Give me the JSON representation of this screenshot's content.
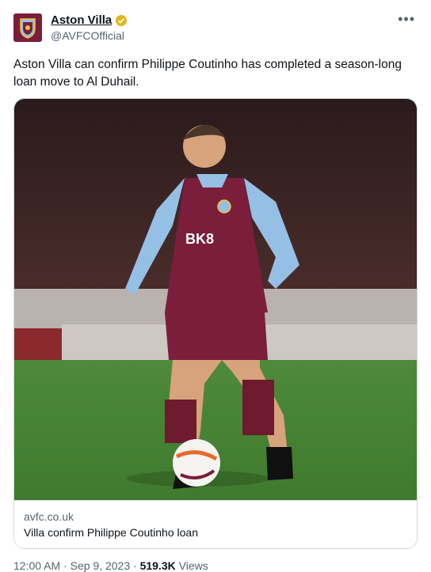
{
  "account": {
    "name": "Aston Villa",
    "handle": "@AVFCOfficial",
    "avatar_icon": "villa-crest-icon",
    "verified_icon": "verified-gold-badge-icon"
  },
  "tweet": {
    "text": "Aston Villa can confirm Philippe Coutinho has completed a season-long loan move to Al Duhail.",
    "more_label": "•••"
  },
  "card": {
    "domain": "avfc.co.uk",
    "title": "Villa confirm Philippe Coutinho loan",
    "shirt_sponsor": "BK8"
  },
  "meta": {
    "time": "12:00 AM",
    "date": "Sep 9, 2023",
    "views_count": "519.3K",
    "views_label": "Views",
    "sep": "·"
  },
  "colors": {
    "claret": "#7a1e3c",
    "sky_blue": "#95bfe5",
    "verified_gold": "#e2b719"
  }
}
